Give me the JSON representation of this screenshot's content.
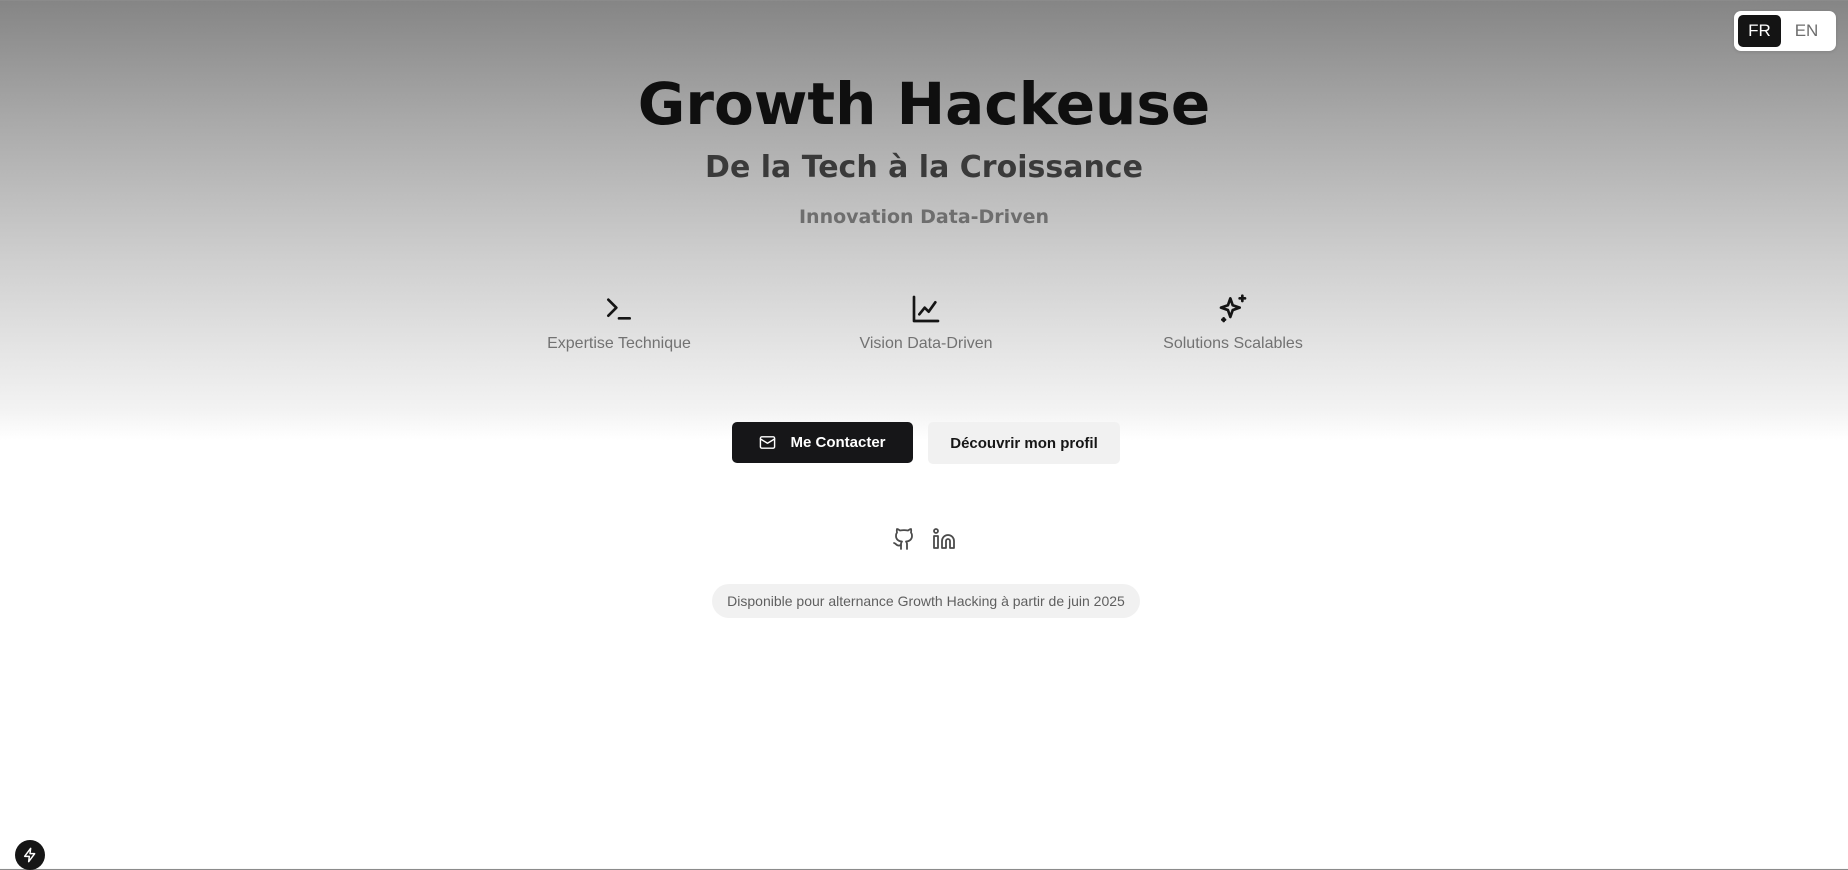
{
  "language_switch": {
    "options": [
      {
        "code": "FR",
        "active": true
      },
      {
        "code": "EN",
        "active": false
      }
    ]
  },
  "hero": {
    "title": "Growth Hackeuse",
    "subtitle": "De la Tech à la Croissance",
    "tagline": "Innovation Data-Driven"
  },
  "features": [
    {
      "icon": "terminal-icon",
      "label": "Expertise Technique"
    },
    {
      "icon": "line-chart-icon",
      "label": "Vision Data-Driven"
    },
    {
      "icon": "sparkles-icon",
      "label": "Solutions Scalables"
    }
  ],
  "actions": {
    "contact_label": "Me Contacter",
    "contact_icon": "mail-icon",
    "profile_label": "Découvrir mon profil"
  },
  "socials": [
    {
      "icon": "github-icon"
    },
    {
      "icon": "linkedin-icon"
    }
  ],
  "availability_text": "Disponible pour alternance Growth Hacking à partir de juin 2025",
  "colors": {
    "primary_dark": "#161618",
    "muted_text": "#727272",
    "pill_background": "#f1f1f1"
  }
}
